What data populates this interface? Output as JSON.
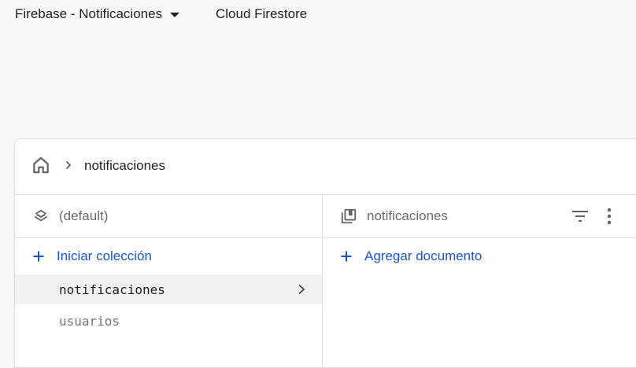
{
  "topbar": {
    "project_name": "Firebase - Notificaciones",
    "product_name": "Cloud Firestore"
  },
  "breadcrumb": {
    "items": [
      "notificaciones"
    ]
  },
  "root_panel": {
    "title": "(default)",
    "action_label": "Iniciar colección",
    "collections": [
      {
        "name": "notificaciones",
        "selected": true
      },
      {
        "name": "usuarios",
        "selected": false
      }
    ]
  },
  "collection_panel": {
    "title": "notificaciones",
    "action_label": "Agregar documento"
  },
  "colors": {
    "accent": "#1a56c4",
    "border": "#dadce0",
    "selected_bg": "#f1f1f1",
    "icon": "#5f6368"
  },
  "icons": {
    "home": "home-icon",
    "breadcrumb_separator": "chevron-right-icon",
    "database": "database-layers-icon",
    "collection": "collection-stack-icon",
    "filter": "filter-icon",
    "more": "more-vert-icon",
    "add": "plus-icon"
  }
}
